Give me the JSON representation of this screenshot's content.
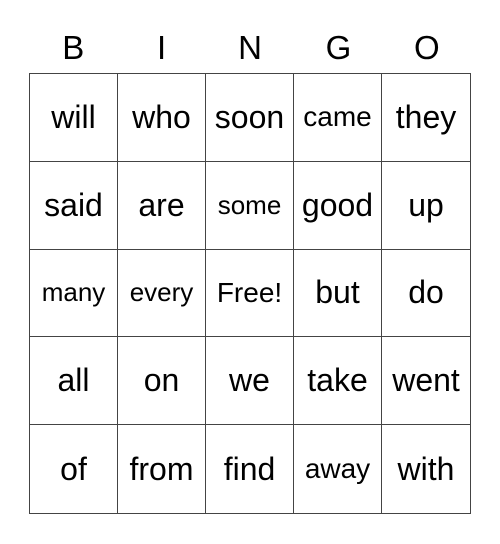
{
  "header": [
    "B",
    "I",
    "N",
    "G",
    "O"
  ],
  "rows": [
    [
      "will",
      "who",
      "soon",
      "came",
      "they"
    ],
    [
      "said",
      "are",
      "some",
      "good",
      "up"
    ],
    [
      "many",
      "every",
      "Free!",
      "but",
      "do"
    ],
    [
      "all",
      "on",
      "we",
      "take",
      "went"
    ],
    [
      "of",
      "from",
      "find",
      "away",
      "with"
    ]
  ]
}
